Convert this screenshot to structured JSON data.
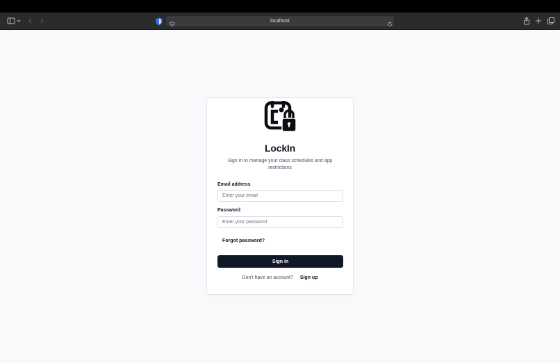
{
  "browser": {
    "url": "localhost"
  },
  "app": {
    "title": "LockIn",
    "subtitle": "Sign in to manage your class schedules and app restrictions"
  },
  "form": {
    "email_label": "Email address",
    "email_placeholder": "Enter your email",
    "email_value": "",
    "password_label": "Password",
    "password_placeholder": "Enter your password",
    "password_value": "",
    "forgot_label": "Forgot password?",
    "signin_label": "Sign in"
  },
  "footer": {
    "prompt": "Don't have an account?",
    "signup_label": "Sign up"
  },
  "colors": {
    "primary_button": "#111827",
    "background": "#f8f9fb",
    "toolbar": "#2b2b2d"
  },
  "icons": {
    "sidebar": "sidebar-icon",
    "back": "chevron-left-icon",
    "forward": "chevron-right-icon",
    "extension": "shield-icon",
    "site": "page-icon",
    "reload": "reload-icon",
    "share": "share-icon",
    "new_tab": "plus-icon",
    "tabs": "tabs-icon",
    "logo": "calendar-lock-icon"
  }
}
